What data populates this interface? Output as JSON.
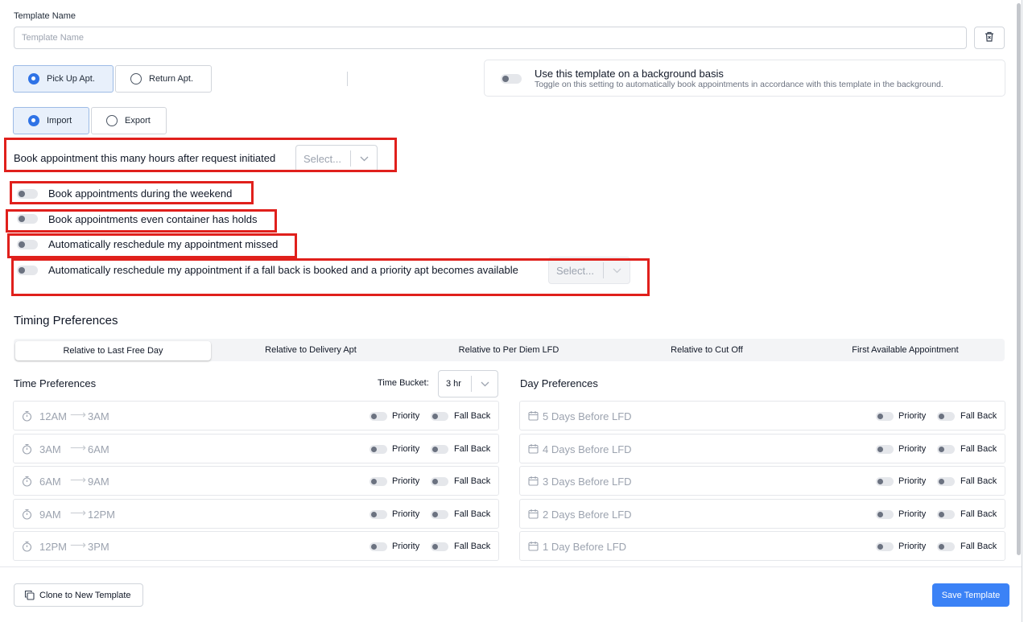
{
  "template_name": {
    "label": "Template Name",
    "placeholder": "Template Name",
    "value": ""
  },
  "trash_button": {
    "icon": "trash-icon"
  },
  "apt_type": {
    "options": [
      "Pick Up Apt.",
      "Return Apt."
    ],
    "selected": "Pick Up Apt."
  },
  "direction": {
    "options": [
      "Import",
      "Export"
    ],
    "selected": "Import"
  },
  "background": {
    "title": "Use this template on a background basis",
    "subtitle": "Toggle on this setting to automatically book appointments in accordance with this template in the background.",
    "enabled": false
  },
  "settings": {
    "hours_after": {
      "label": "Book appointment this many hours after request initiated",
      "placeholder": "Select..."
    },
    "weekend": {
      "label": "Book appointments during the weekend",
      "enabled": false
    },
    "holds": {
      "label": "Book appointments even container has holds",
      "enabled": false
    },
    "missed": {
      "label": "Automatically reschedule my appointment missed",
      "enabled": false
    },
    "fallback": {
      "label": "Automatically reschedule my appointment if a fall back is booked and a priority apt becomes available",
      "placeholder": "Select...",
      "enabled": false
    }
  },
  "timing": {
    "title": "Timing Preferences",
    "tabs": [
      "Relative to Last Free Day",
      "Relative to Delivery Apt",
      "Relative to Per Diem LFD",
      "Relative to Cut Off",
      "First Available Appointment"
    ],
    "active_tab": "Relative to Last Free Day"
  },
  "time_prefs": {
    "title": "Time Preferences",
    "bucket_label": "Time Bucket:",
    "bucket_value": "3 hr",
    "priority_label": "Priority",
    "fallback_label": "Fall Back",
    "rows": [
      {
        "from": "12AM",
        "to": "3AM"
      },
      {
        "from": "3AM",
        "to": "6AM"
      },
      {
        "from": "6AM",
        "to": "9AM"
      },
      {
        "from": "9AM",
        "to": "12PM"
      },
      {
        "from": "12PM",
        "to": "3PM"
      }
    ]
  },
  "day_prefs": {
    "title": "Day Preferences",
    "priority_label": "Priority",
    "fallback_label": "Fall Back",
    "rows": [
      "5 Days Before LFD",
      "4 Days Before LFD",
      "3 Days Before LFD",
      "2 Days Before LFD",
      "1 Day Before LFD"
    ]
  },
  "footer": {
    "clone_label": "Clone to New Template",
    "save_label": "Save Template"
  },
  "colors": {
    "accent": "#3b82f6",
    "highlight": "#e0201c",
    "selected_bg": "#e8f0fb"
  }
}
